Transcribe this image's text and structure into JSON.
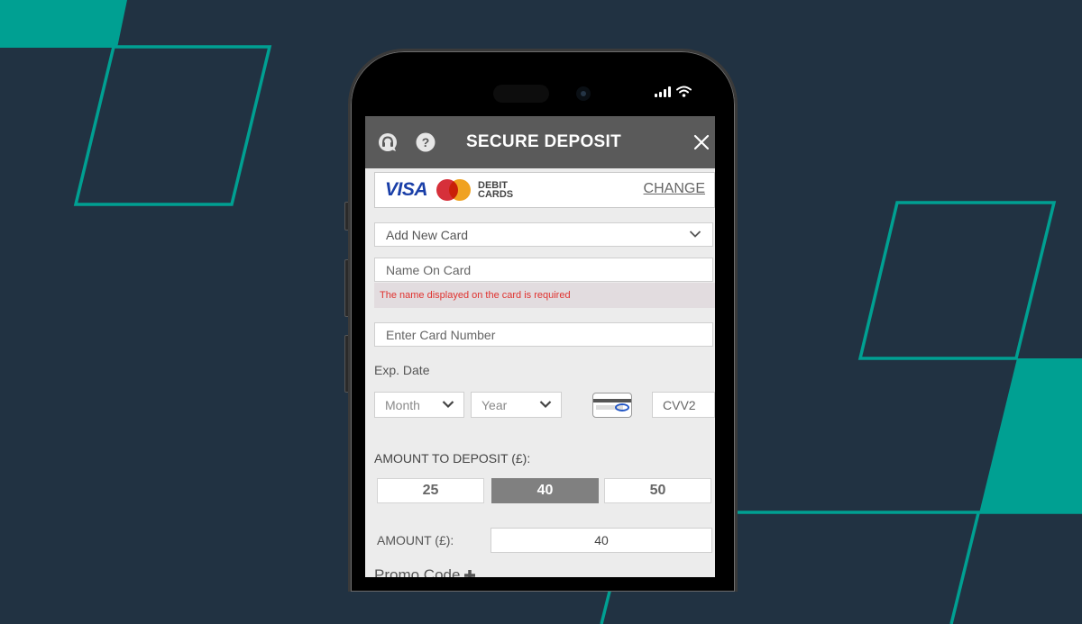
{
  "colors": {
    "background": "#213242",
    "accent_teal": "#00a092",
    "header_bg": "#5a5a5a",
    "error_text": "#e0322f",
    "selected_amount_bg": "#808080",
    "visa_blue": "#1a3fa8"
  },
  "status_bar": {
    "icons": [
      "signal-icon",
      "wifi-icon"
    ]
  },
  "header": {
    "title": "SECURE DEPOSIT",
    "icons": [
      "support-chat-icon",
      "help-icon",
      "close-icon"
    ]
  },
  "payment_method": {
    "visa_label": "VISA",
    "debit_line1": "DEBIT",
    "debit_line2": "CARDS",
    "change_label": "CHANGE"
  },
  "form": {
    "card_select_value": "Add New Card",
    "name_placeholder": "Name On Card",
    "name_error": "The name displayed on the card is required",
    "card_number_placeholder": "Enter Card Number",
    "exp_date_label": "Exp. Date",
    "month_placeholder": "Month",
    "year_placeholder": "Year",
    "cvv_placeholder": "CVV2"
  },
  "deposit": {
    "label": "AMOUNT TO DEPOSIT (£):",
    "options": [
      "25",
      "40",
      "50"
    ],
    "selected": "40",
    "amount_label": "AMOUNT (£):",
    "amount_value": "40",
    "promo_label": "Promo Code"
  }
}
